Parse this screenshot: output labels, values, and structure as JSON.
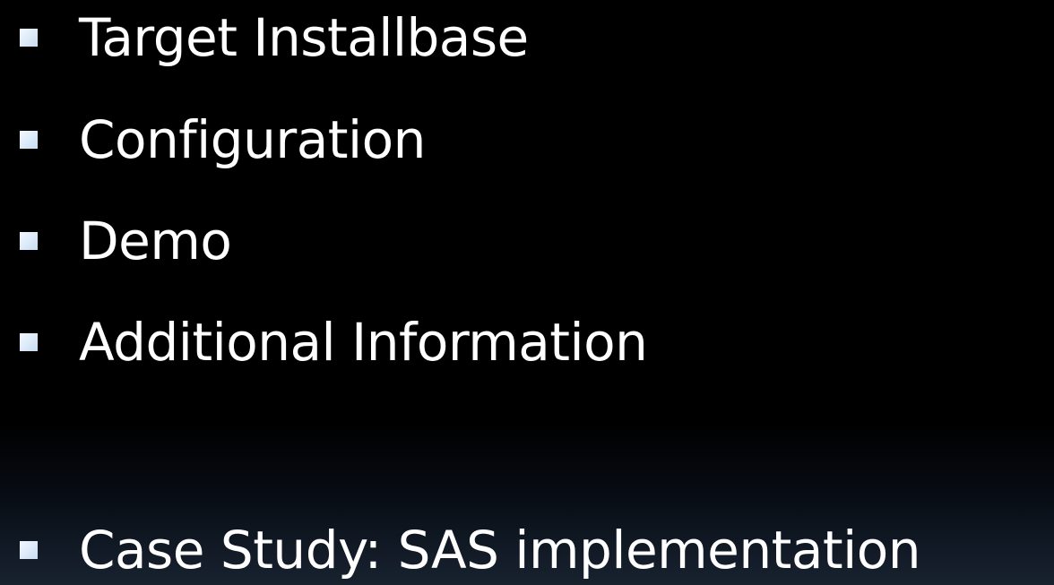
{
  "slide": {
    "bullets": [
      {
        "label": "Target Installbase"
      },
      {
        "label": "Configuration"
      },
      {
        "label": "Demo"
      },
      {
        "label": "Additional Information"
      },
      {
        "label": "Case Study: SAS implementation"
      }
    ]
  },
  "colors": {
    "background": "#000000",
    "text": "#ffffff",
    "bullet_marker": "#d8e8f8"
  },
  "icons": {
    "bullet": "square-bullet-icon"
  }
}
